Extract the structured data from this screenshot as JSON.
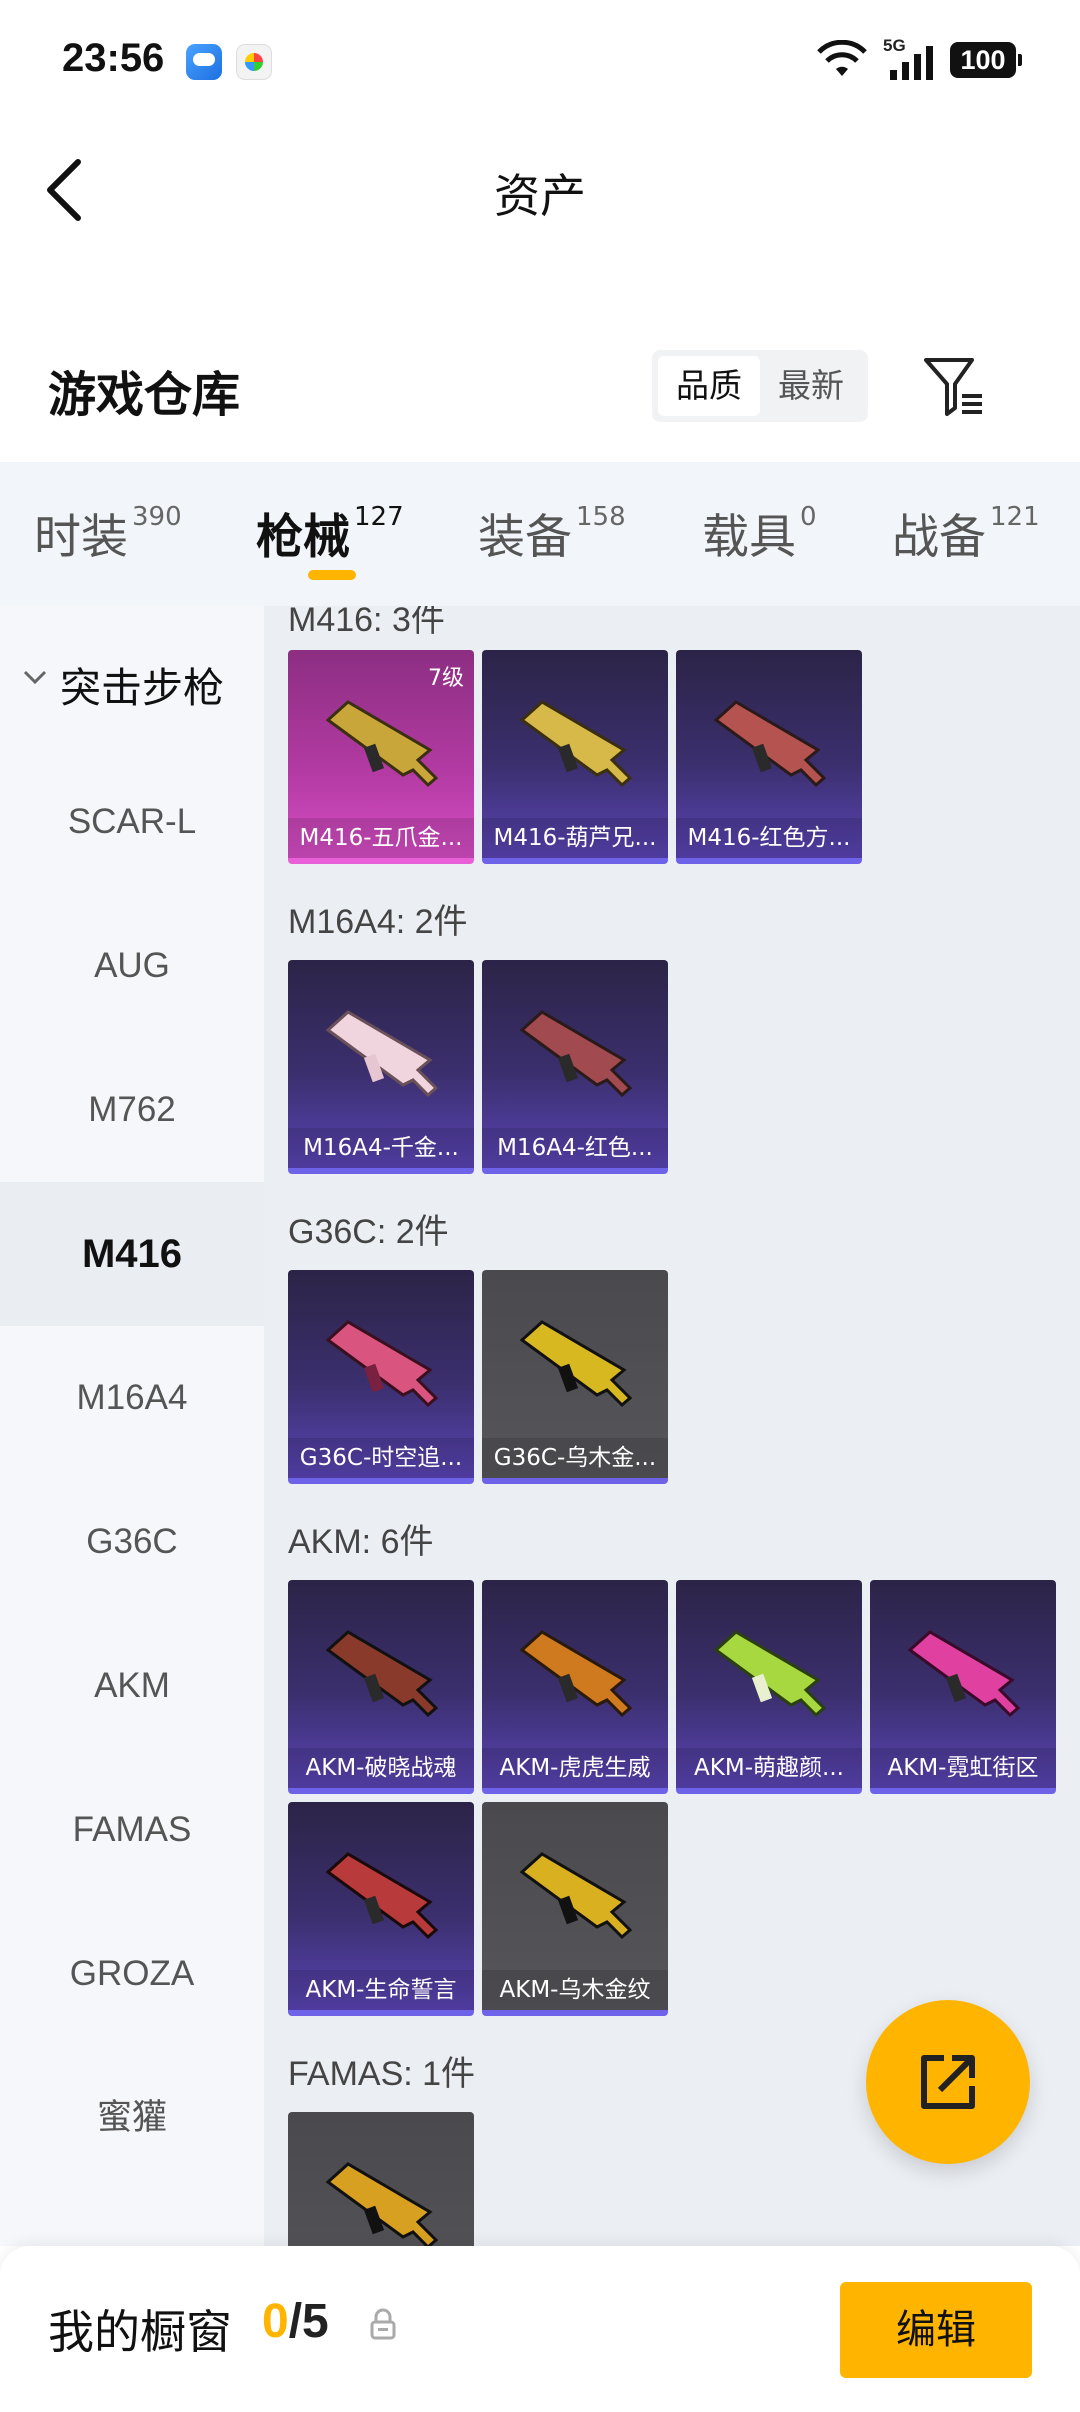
{
  "status_bar": {
    "time": "23:56",
    "network": "5G",
    "battery": "100"
  },
  "header": {
    "title": "资产"
  },
  "warehouse": {
    "title": "游戏仓库",
    "sort_options": [
      "品质",
      "最新"
    ]
  },
  "tabs": [
    {
      "label": "时装",
      "count": "390"
    },
    {
      "label": "枪械",
      "count": "127",
      "active": true
    },
    {
      "label": "装备",
      "count": "158"
    },
    {
      "label": "载具",
      "count": "0"
    },
    {
      "label": "战备",
      "count": "121"
    }
  ],
  "sidebar": {
    "group_label": "突击步枪",
    "items": [
      "SCAR-L",
      "AUG",
      "M762",
      "M416",
      "M16A4",
      "G36C",
      "AKM",
      "FAMAS",
      "GROZA",
      "蜜獾"
    ],
    "active": "M416"
  },
  "sections": [
    {
      "title": "M416: 3件",
      "items": [
        {
          "name": "M416-五爪金...",
          "level": "7级",
          "rarity": "pink"
        },
        {
          "name": "M416-葫芦兄...",
          "rarity": "purple"
        },
        {
          "name": "M416-红色方...",
          "rarity": "purple"
        }
      ]
    },
    {
      "title": "M16A4: 2件",
      "items": [
        {
          "name": "M16A4-千金...",
          "rarity": "purple"
        },
        {
          "name": "M16A4-红色...",
          "rarity": "purple"
        }
      ]
    },
    {
      "title": "G36C: 2件",
      "items": [
        {
          "name": "G36C-时空追...",
          "rarity": "purple"
        },
        {
          "name": "G36C-乌木金...",
          "rarity": "gray"
        }
      ]
    },
    {
      "title": "AKM: 6件",
      "items": [
        {
          "name": "AKM-破晓战魂",
          "rarity": "purple"
        },
        {
          "name": "AKM-虎虎生威",
          "rarity": "purple"
        },
        {
          "name": "AKM-萌趣颜...",
          "rarity": "purple"
        },
        {
          "name": "AKM-霓虹街区",
          "rarity": "purple"
        },
        {
          "name": "AKM-生命誓言",
          "rarity": "purple"
        },
        {
          "name": "AKM-乌木金纹",
          "rarity": "gray"
        }
      ]
    },
    {
      "title": "FAMAS: 1件",
      "items": [
        {
          "name": "",
          "rarity": "gray"
        }
      ]
    }
  ],
  "bottom": {
    "showcase_label": "我的橱窗",
    "current": "0",
    "total": "/5",
    "edit_label": "编辑"
  },
  "colors": {
    "accent": "#ffb400",
    "purple_rarity": "#6e62e8",
    "pink_rarity": "#e85fd8"
  }
}
